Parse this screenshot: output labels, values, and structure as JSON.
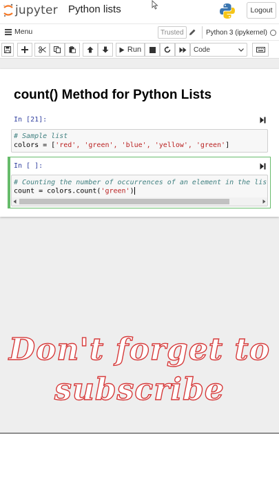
{
  "header": {
    "logo_text": "jupyter",
    "notebook_title": "Python lists",
    "logout_label": "Logout"
  },
  "menubar": {
    "menu_label": "Menu",
    "trusted_label": "Trusted",
    "kernel_label": "Python 3 (ipykernel)"
  },
  "toolbar": {
    "run_label": "Run",
    "cell_type_value": "Code"
  },
  "notebook": {
    "heading": "count() Method for Python Lists",
    "cells": [
      {
        "prompt": "In [21]:",
        "comment": "# Sample list",
        "code_prefix": "colors = [",
        "code_items": "'red', 'green', 'blue', 'yellow', 'green'",
        "code_suffix": "]"
      },
      {
        "prompt": "In [ ]:",
        "comment": "# Counting the number of occurrences of an element in the list u",
        "code_prefix": "count = colors.count(",
        "code_arg": "'green'",
        "code_suffix": ")"
      }
    ]
  },
  "overlay": {
    "line1": "Don't forget to",
    "line2": "subscribe"
  },
  "colors": {
    "overlay_stroke": "#d63a3a",
    "selected_cell": "#66bb6a",
    "jupyter_orange": "#f37726"
  }
}
